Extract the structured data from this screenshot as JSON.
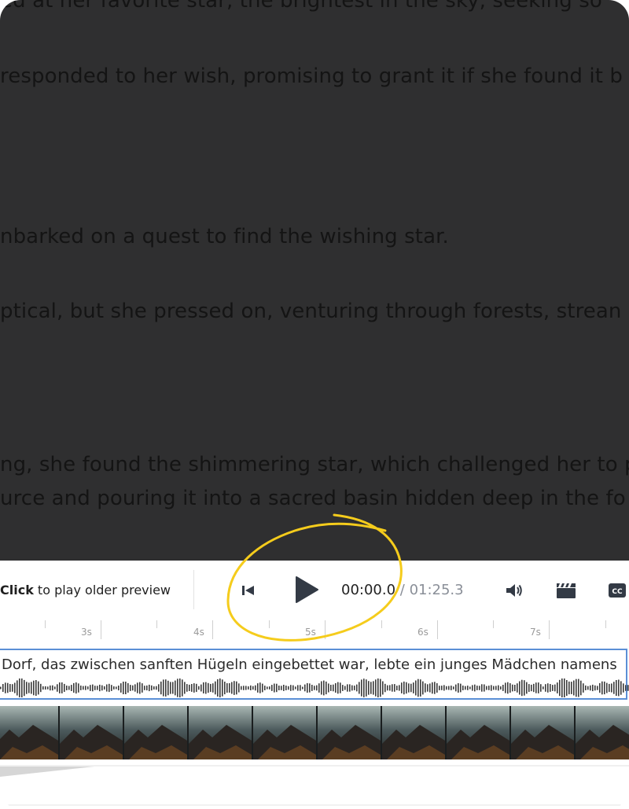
{
  "story": {
    "lines": [
      "ed at her favorite star, the brightest in the sky, seeking so",
      "responded to her wish, promising to grant it if she found it b",
      "nbarked on a quest to find the wishing star.",
      "ptical, but she pressed on, venturing through forests, strean",
      "ng, she found the shimmering star, which challenged her to p",
      "urce and pouring it into a sacred basin hidden deep in the fo"
    ]
  },
  "player": {
    "hint_bold": "Click",
    "hint_rest": " to play older preview",
    "current_time": "00:00.0",
    "separator": " / ",
    "total_time": "01:25.3",
    "icons": [
      "skip-back-icon",
      "play-icon",
      "volume-icon",
      "clapperboard-icon",
      "cc-icon"
    ]
  },
  "timeline": {
    "ticks": [
      "3s",
      "4s",
      "5s",
      "6s",
      "7s"
    ]
  },
  "caption": {
    "text": "Dorf, das zwischen sanften Hügeln eingebettet war, lebte ein junges Mädchen namens"
  },
  "colors": {
    "overlay": "#2f2f30",
    "accent_border": "#5b8fd6",
    "annotation": "#f5cc1c",
    "controls": "#333a45"
  }
}
